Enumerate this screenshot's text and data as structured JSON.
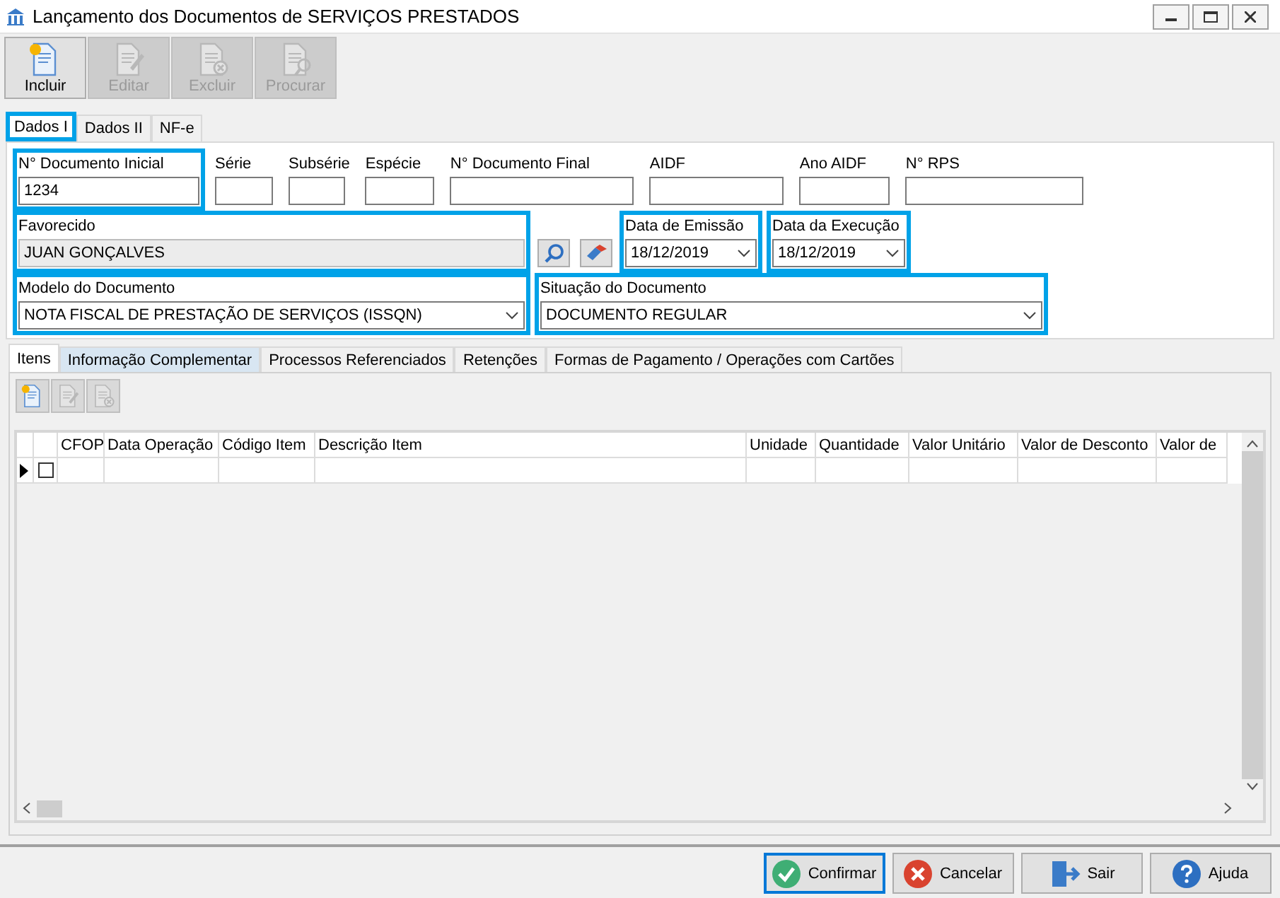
{
  "window": {
    "title": "Lançamento dos Documentos de SERVIÇOS PRESTADOS"
  },
  "toolbar": [
    {
      "label": "Incluir",
      "kind": "new",
      "disabled": false
    },
    {
      "label": "Editar",
      "kind": "edit",
      "disabled": true
    },
    {
      "label": "Excluir",
      "kind": "delete",
      "disabled": true
    },
    {
      "label": "Procurar",
      "kind": "find",
      "disabled": true
    }
  ],
  "tabs": [
    {
      "label": "Dados I",
      "selected": true,
      "highlighted": true
    },
    {
      "label": "Dados II",
      "selected": false,
      "highlighted": false
    },
    {
      "label": "NF-e",
      "selected": false,
      "highlighted": false
    }
  ],
  "field_rows": [
    [
      {
        "kind": "text",
        "label": "N° Documento Inicial",
        "value": "1234",
        "highlighted": true
      },
      {
        "kind": "text",
        "label": "Série",
        "highlighted": false
      },
      {
        "kind": "text",
        "label": "Subsérie",
        "highlighted": false
      },
      {
        "kind": "text",
        "label": "Espécie",
        "highlighted": false
      },
      {
        "kind": "text",
        "label": "N° Documento Final",
        "highlighted": false
      },
      {
        "kind": "text",
        "label": "AIDF",
        "highlighted": false
      },
      {
        "kind": "text",
        "label": "Ano AIDF",
        "highlighted": false
      },
      {
        "kind": "text",
        "label": "N° RPS",
        "highlighted": false
      }
    ],
    [
      {
        "kind": "readonly",
        "label": "Favorecido",
        "value": "JUAN GONÇALVES",
        "highlighted": true
      },
      {
        "kind": "search"
      },
      {
        "kind": "clear"
      },
      {
        "kind": "date",
        "label": "Data de Emissão",
        "value": "18/12/2019",
        "highlighted": true
      },
      {
        "kind": "date",
        "label": "Data da Execução",
        "value": "18/12/2019",
        "highlighted": true
      }
    ],
    [
      {
        "kind": "combo",
        "label": "Modelo do Documento",
        "value": "NOTA FISCAL DE PRESTAÇÃO DE SERVIÇOS (ISSQN)",
        "highlighted": true
      },
      {
        "kind": "combo",
        "label": "Situação do Documento",
        "value": "DOCUMENTO REGULAR",
        "highlighted": true
      }
    ]
  ],
  "subtabs": [
    {
      "label": "Itens",
      "selected": true,
      "hovered": false
    },
    {
      "label": "Informação Complementar",
      "selected": false,
      "hovered": true
    },
    {
      "label": "Processos Referenciados",
      "selected": false,
      "hovered": false
    },
    {
      "label": "Retenções",
      "selected": false,
      "hovered": false
    },
    {
      "label": "Formas de Pagamento / Operações com Cartões",
      "selected": false,
      "hovered": false
    }
  ],
  "item_toolbar": [
    {
      "kind": "new",
      "disabled": false
    },
    {
      "kind": "edit",
      "disabled": true
    },
    {
      "kind": "delete",
      "disabled": true
    }
  ],
  "grid": {
    "columns": [
      "CFOP",
      "Data Operação",
      "Código Item",
      "Descrição Item",
      "Unidade",
      "Quantidade",
      "Valor Unitário",
      "Valor de Desconto",
      "Valor de"
    ],
    "rows": [
      {
        "current": true,
        "checked": false
      }
    ]
  },
  "buttons": [
    {
      "label": "Confirmar",
      "kind": "confirm",
      "focused": true
    },
    {
      "label": "Cancelar",
      "kind": "cancel",
      "focused": false
    },
    {
      "label": "Sair",
      "kind": "exit",
      "focused": false
    },
    {
      "label": "Ajuda",
      "kind": "help",
      "focused": false
    }
  ]
}
